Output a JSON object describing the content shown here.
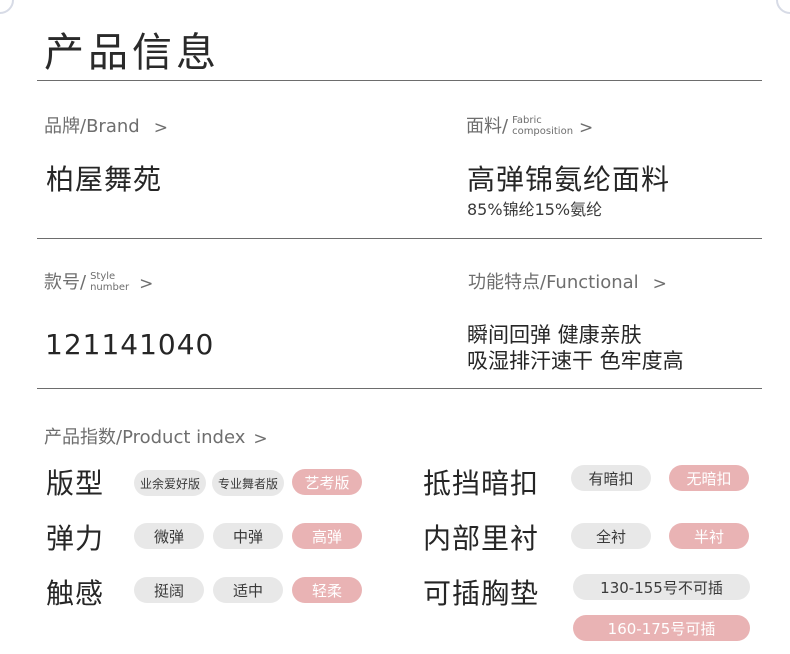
{
  "title": "产品信息",
  "brand": {
    "label": "品牌/Brand",
    "arrow": ">",
    "value": "柏屋舞苑"
  },
  "fabric": {
    "label": "面料/",
    "label_small_1": "Fabric",
    "label_small_2": "composition",
    "arrow": ">",
    "value": "高弹锦氨纶面料",
    "detail": "85%锦纶15%氨纶"
  },
  "style": {
    "label": "款号/",
    "label_small_1": "Style",
    "label_small_2": "number",
    "arrow": ">",
    "value": "121141040"
  },
  "functional": {
    "label": "功能特点/Functional",
    "arrow": ">",
    "line1": "瞬间回弹 健康亲肤",
    "line2": "吸湿排汗速干 色牢度高"
  },
  "product_index": {
    "label": "产品指数/Product index",
    "arrow": ">",
    "fit": {
      "name": "版型",
      "options": [
        "业余爱好版",
        "专业舞者版",
        "艺考版"
      ],
      "selected": "艺考版"
    },
    "elastic": {
      "name": "弹力",
      "options": [
        "微弹",
        "中弹",
        "高弹"
      ],
      "selected": "高弹"
    },
    "feel": {
      "name": "触感",
      "options": [
        "挺阔",
        "适中",
        "轻柔"
      ],
      "selected": "轻柔"
    },
    "hidden_button": {
      "name": "抵挡暗扣",
      "options": [
        "有暗扣",
        "无暗扣"
      ],
      "selected": "无暗扣"
    },
    "lining": {
      "name": "内部里衬",
      "options": [
        "全衬",
        "半衬"
      ],
      "selected": "半衬"
    },
    "chest_pad": {
      "name": "可插胸垫",
      "options": [
        "130-155号不可插",
        "160-175号可插"
      ],
      "selected": "160-175号可插"
    }
  },
  "colors": {
    "accent": "#e9b3b4",
    "pill": "#e8e8e8",
    "rule": "#6d6d6d"
  }
}
